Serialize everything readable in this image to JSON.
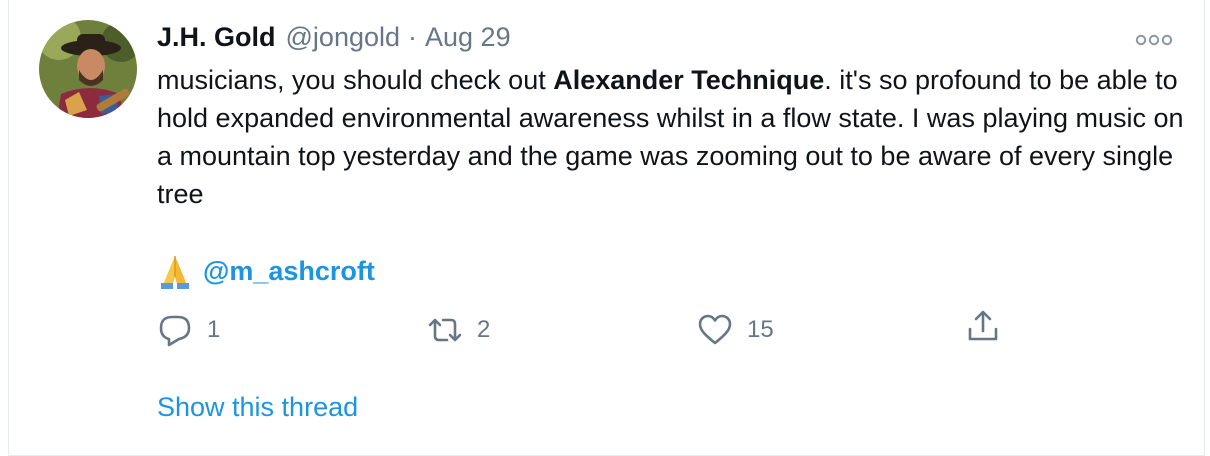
{
  "author": {
    "name": "J.H. Gold",
    "handle": "@jongold",
    "separator": "·",
    "date": "Aug 29"
  },
  "tweet": {
    "text_before": "musicians, you should check out ",
    "text_bold": "Alexander Technique",
    "text_after": ". it's so profound to be able to hold expanded environmental awareness whilst in a flow state. I was playing music on a mountain top yesterday and the game was zooming out to be aware of every single tree",
    "mention_emoji": "🙏",
    "mention": "@m_ashcroft"
  },
  "actions": {
    "reply_count": "1",
    "retweet_count": "2",
    "like_count": "15"
  },
  "show_thread_label": "Show this thread",
  "icons": {
    "avatar": "avatar-photo",
    "more": "more-icon",
    "reply": "reply-icon",
    "retweet": "retweet-icon",
    "like": "heart-icon",
    "share": "share-icon",
    "mention_emoji": "folded-hands-emoji"
  },
  "colors": {
    "text": "#0f1419",
    "secondary": "#657786",
    "link": "#1b95e0",
    "border": "#e6ecf0"
  }
}
